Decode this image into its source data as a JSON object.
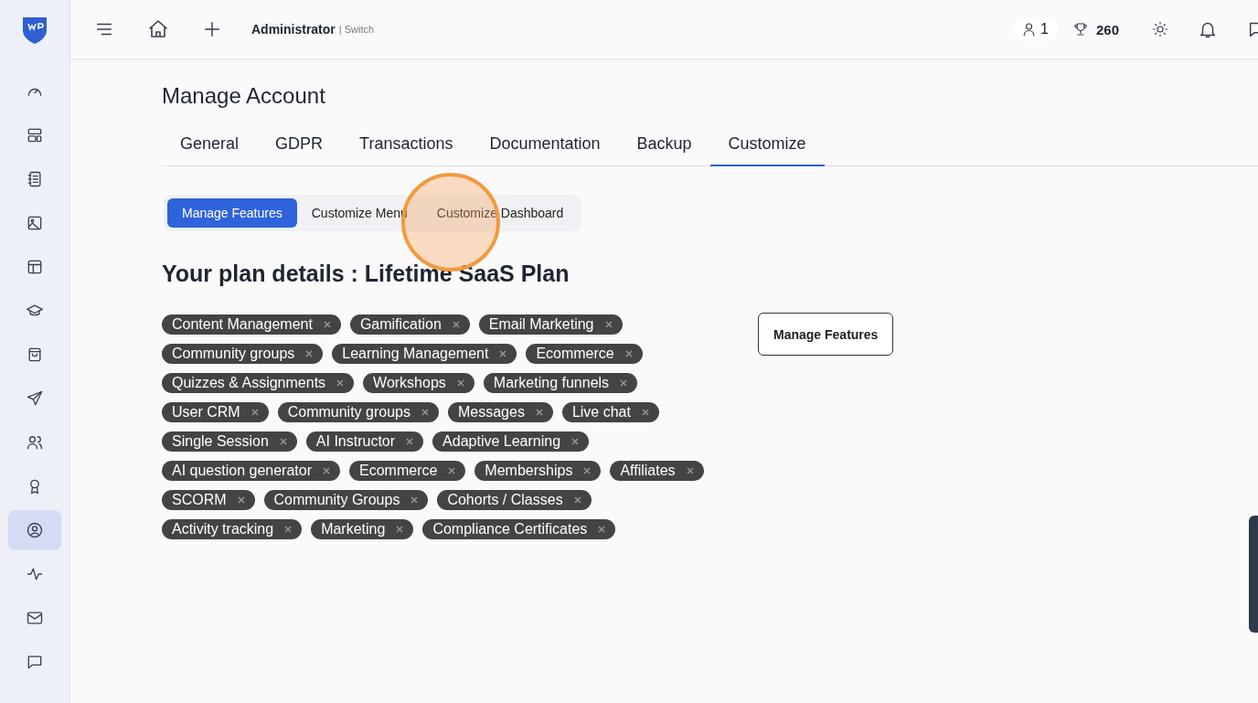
{
  "topbar": {
    "user": "Administrator",
    "switch": "| Switch",
    "online_count": "1",
    "points": "260"
  },
  "sidebar": {
    "items": [
      {
        "selected": false
      },
      {
        "selected": false
      },
      {
        "selected": false
      },
      {
        "selected": false
      },
      {
        "selected": false
      },
      {
        "selected": false
      },
      {
        "selected": false
      },
      {
        "selected": false
      },
      {
        "selected": false
      },
      {
        "selected": false
      },
      {
        "selected": true
      },
      {
        "selected": false
      },
      {
        "selected": false
      },
      {
        "selected": false
      }
    ]
  },
  "page_title": "Manage Account",
  "tabs": [
    {
      "label": "General",
      "selected": false
    },
    {
      "label": "GDPR",
      "selected": false
    },
    {
      "label": "Transactions",
      "selected": false
    },
    {
      "label": "Documentation",
      "selected": false
    },
    {
      "label": "Backup",
      "selected": false
    },
    {
      "label": "Customize",
      "selected": true
    }
  ],
  "subtabs": [
    {
      "label": "Manage Features",
      "selected": true
    },
    {
      "label": "Customize Menu",
      "selected": false
    },
    {
      "label": "Customize Dashboard",
      "selected": false
    }
  ],
  "plan_heading": "Your plan details : Lifetime SaaS Plan",
  "feature_rows": [
    [
      "Content Management",
      "Gamification",
      "Email Marketing"
    ],
    [
      "Community groups",
      "Learning Management",
      "Ecommerce"
    ],
    [
      "Quizzes & Assignments",
      "Workshops",
      "Marketing funnels"
    ],
    [
      "User CRM",
      "Community groups",
      "Messages",
      "Live chat"
    ],
    [
      "Single Session",
      "AI Instructor",
      "Adaptive Learning"
    ],
    [
      "AI question generator",
      "Ecommerce",
      "Memberships",
      "Affiliates"
    ],
    [
      "SCORM",
      "Community Groups",
      "Cohorts / Classes"
    ],
    [
      "Activity tracking",
      "Marketing",
      "Compliance Certificates"
    ]
  ],
  "manage_button": "Manage Features"
}
